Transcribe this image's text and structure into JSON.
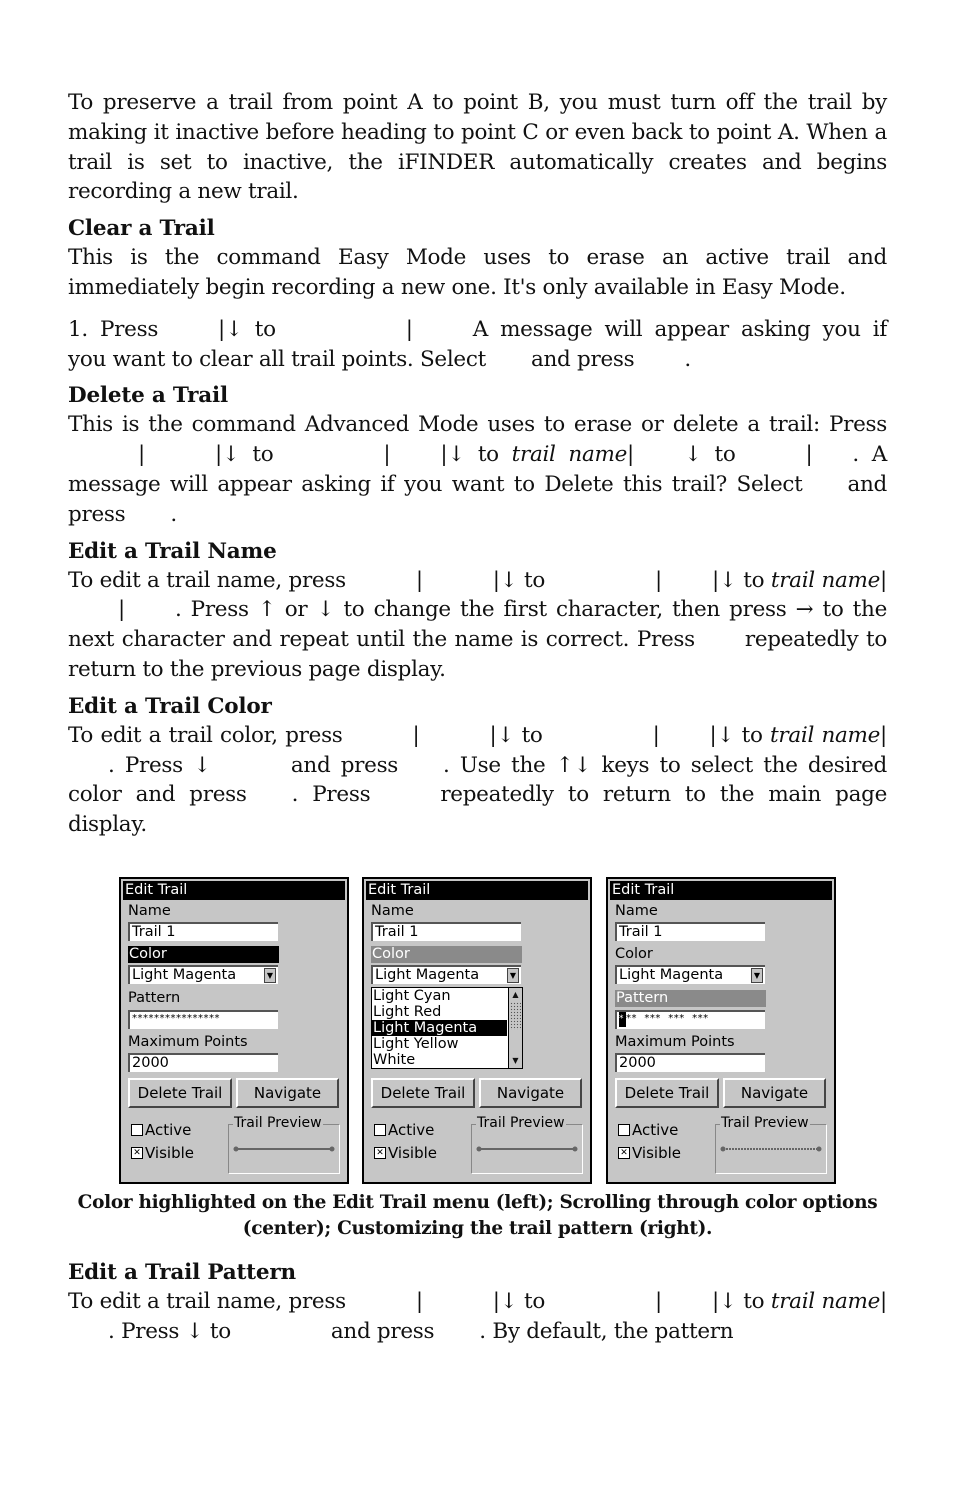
{
  "intro": {
    "text": "To preserve a trail from point A to point B, you must turn off the trail by making it inactive before heading to point C or even back to point A. When a trail is set to inactive, the iFINDER automatically creates and begins recording a new trail."
  },
  "sections": {
    "clear": {
      "heading": "Clear a Trail",
      "body": "This is the command Easy Mode uses to erase an active trail and immediately begin recording a new one. It's only available in Easy Mode.",
      "step_parts": [
        "1. Press",
        "|↓ to",
        "|",
        "A message will appear asking you if you want to clear all trail points. Select",
        "and press",
        "."
      ]
    },
    "delete": {
      "heading": "Delete a Trail",
      "parts": [
        "This is the command Advanced Mode uses to erase or delete a trail: Press",
        "|",
        "|↓ to",
        "|",
        "|↓ to",
        "trail name",
        "|",
        "↓ to",
        "|",
        ". A message will appear asking if you want to Delete this trail? Select",
        "and press",
        "."
      ]
    },
    "edit_name": {
      "heading": "Edit a Trail Name",
      "parts": [
        "To edit a trail name, press",
        "|",
        "|↓ to",
        "|",
        "|↓ to",
        "trail name",
        "|",
        "|",
        ". Press ↑ or ↓ to change the first character, then press → to the next character and repeat until the name is correct. Press",
        "repeatedly to return to the previous page display."
      ]
    },
    "edit_color": {
      "heading": "Edit a Trail Color",
      "parts": [
        "To edit a trail color, press",
        "|",
        "|↓ to",
        "|",
        "|↓ to",
        "trail name",
        "|",
        ". Press ↓",
        "and press",
        ". Use the ↑↓ keys to select the desired color and press",
        ". Press",
        "repeatedly to return to the main page display."
      ]
    },
    "edit_pattern": {
      "heading": "Edit a Trail Pattern",
      "parts": [
        "To edit a trail name, press",
        "|",
        "|↓ to",
        "|",
        "|↓ to",
        "trail name",
        "|",
        ". Press ↓ to",
        "and press",
        ". By default, the pattern"
      ]
    }
  },
  "figure": {
    "caption": "Color highlighted on the Edit Trail menu (left); Scrolling through color options (center); Customizing the trail pattern (right).",
    "panels": [
      {
        "title": "Edit Trail",
        "name_label": "Name",
        "name_value": "Trail 1",
        "color_label": "Color",
        "color_value": "Light Magenta",
        "pattern_label": "Pattern",
        "pattern_value": "****************",
        "max_points_label": "Maximum Points",
        "max_points_value": "2000",
        "delete_button": "Delete Trail",
        "navigate_button": "Navigate",
        "active_label": "Active",
        "active_checked": false,
        "visible_label": "Visible",
        "visible_checked": true,
        "preview_label": "Trail Preview",
        "highlight": "Color"
      },
      {
        "title": "Edit Trail",
        "name_label": "Name",
        "name_value": "Trail 1",
        "color_label": "Color",
        "color_value": "Light Magenta",
        "color_options": [
          "Light Cyan",
          "Light Red",
          "Light Magenta",
          "Light Yellow",
          "White"
        ],
        "selected_option": "Light Magenta",
        "delete_button": "Delete Trail",
        "navigate_button": "Navigate",
        "active_label": "Active",
        "active_checked": false,
        "visible_label": "Visible",
        "visible_checked": true,
        "preview_label": "Trail Preview",
        "highlight": "Color"
      },
      {
        "title": "Edit Trail",
        "name_label": "Name",
        "name_value": "Trail 1",
        "color_label": "Color",
        "color_value": "Light Magenta",
        "pattern_label": "Pattern",
        "pattern_cursor": "*",
        "pattern_value": "**  ***  ***  ***",
        "max_points_label": "Maximum Points",
        "max_points_value": "2000",
        "delete_button": "Delete Trail",
        "navigate_button": "Navigate",
        "active_label": "Active",
        "active_checked": false,
        "visible_label": "Visible",
        "visible_checked": true,
        "preview_label": "Trail Preview",
        "highlight": "Pattern"
      }
    ]
  },
  "symbols": {
    "checked": "✕",
    "unchecked": "",
    "dropdown": "▼",
    "scroll_up": "▲",
    "scroll_down": "▼"
  }
}
